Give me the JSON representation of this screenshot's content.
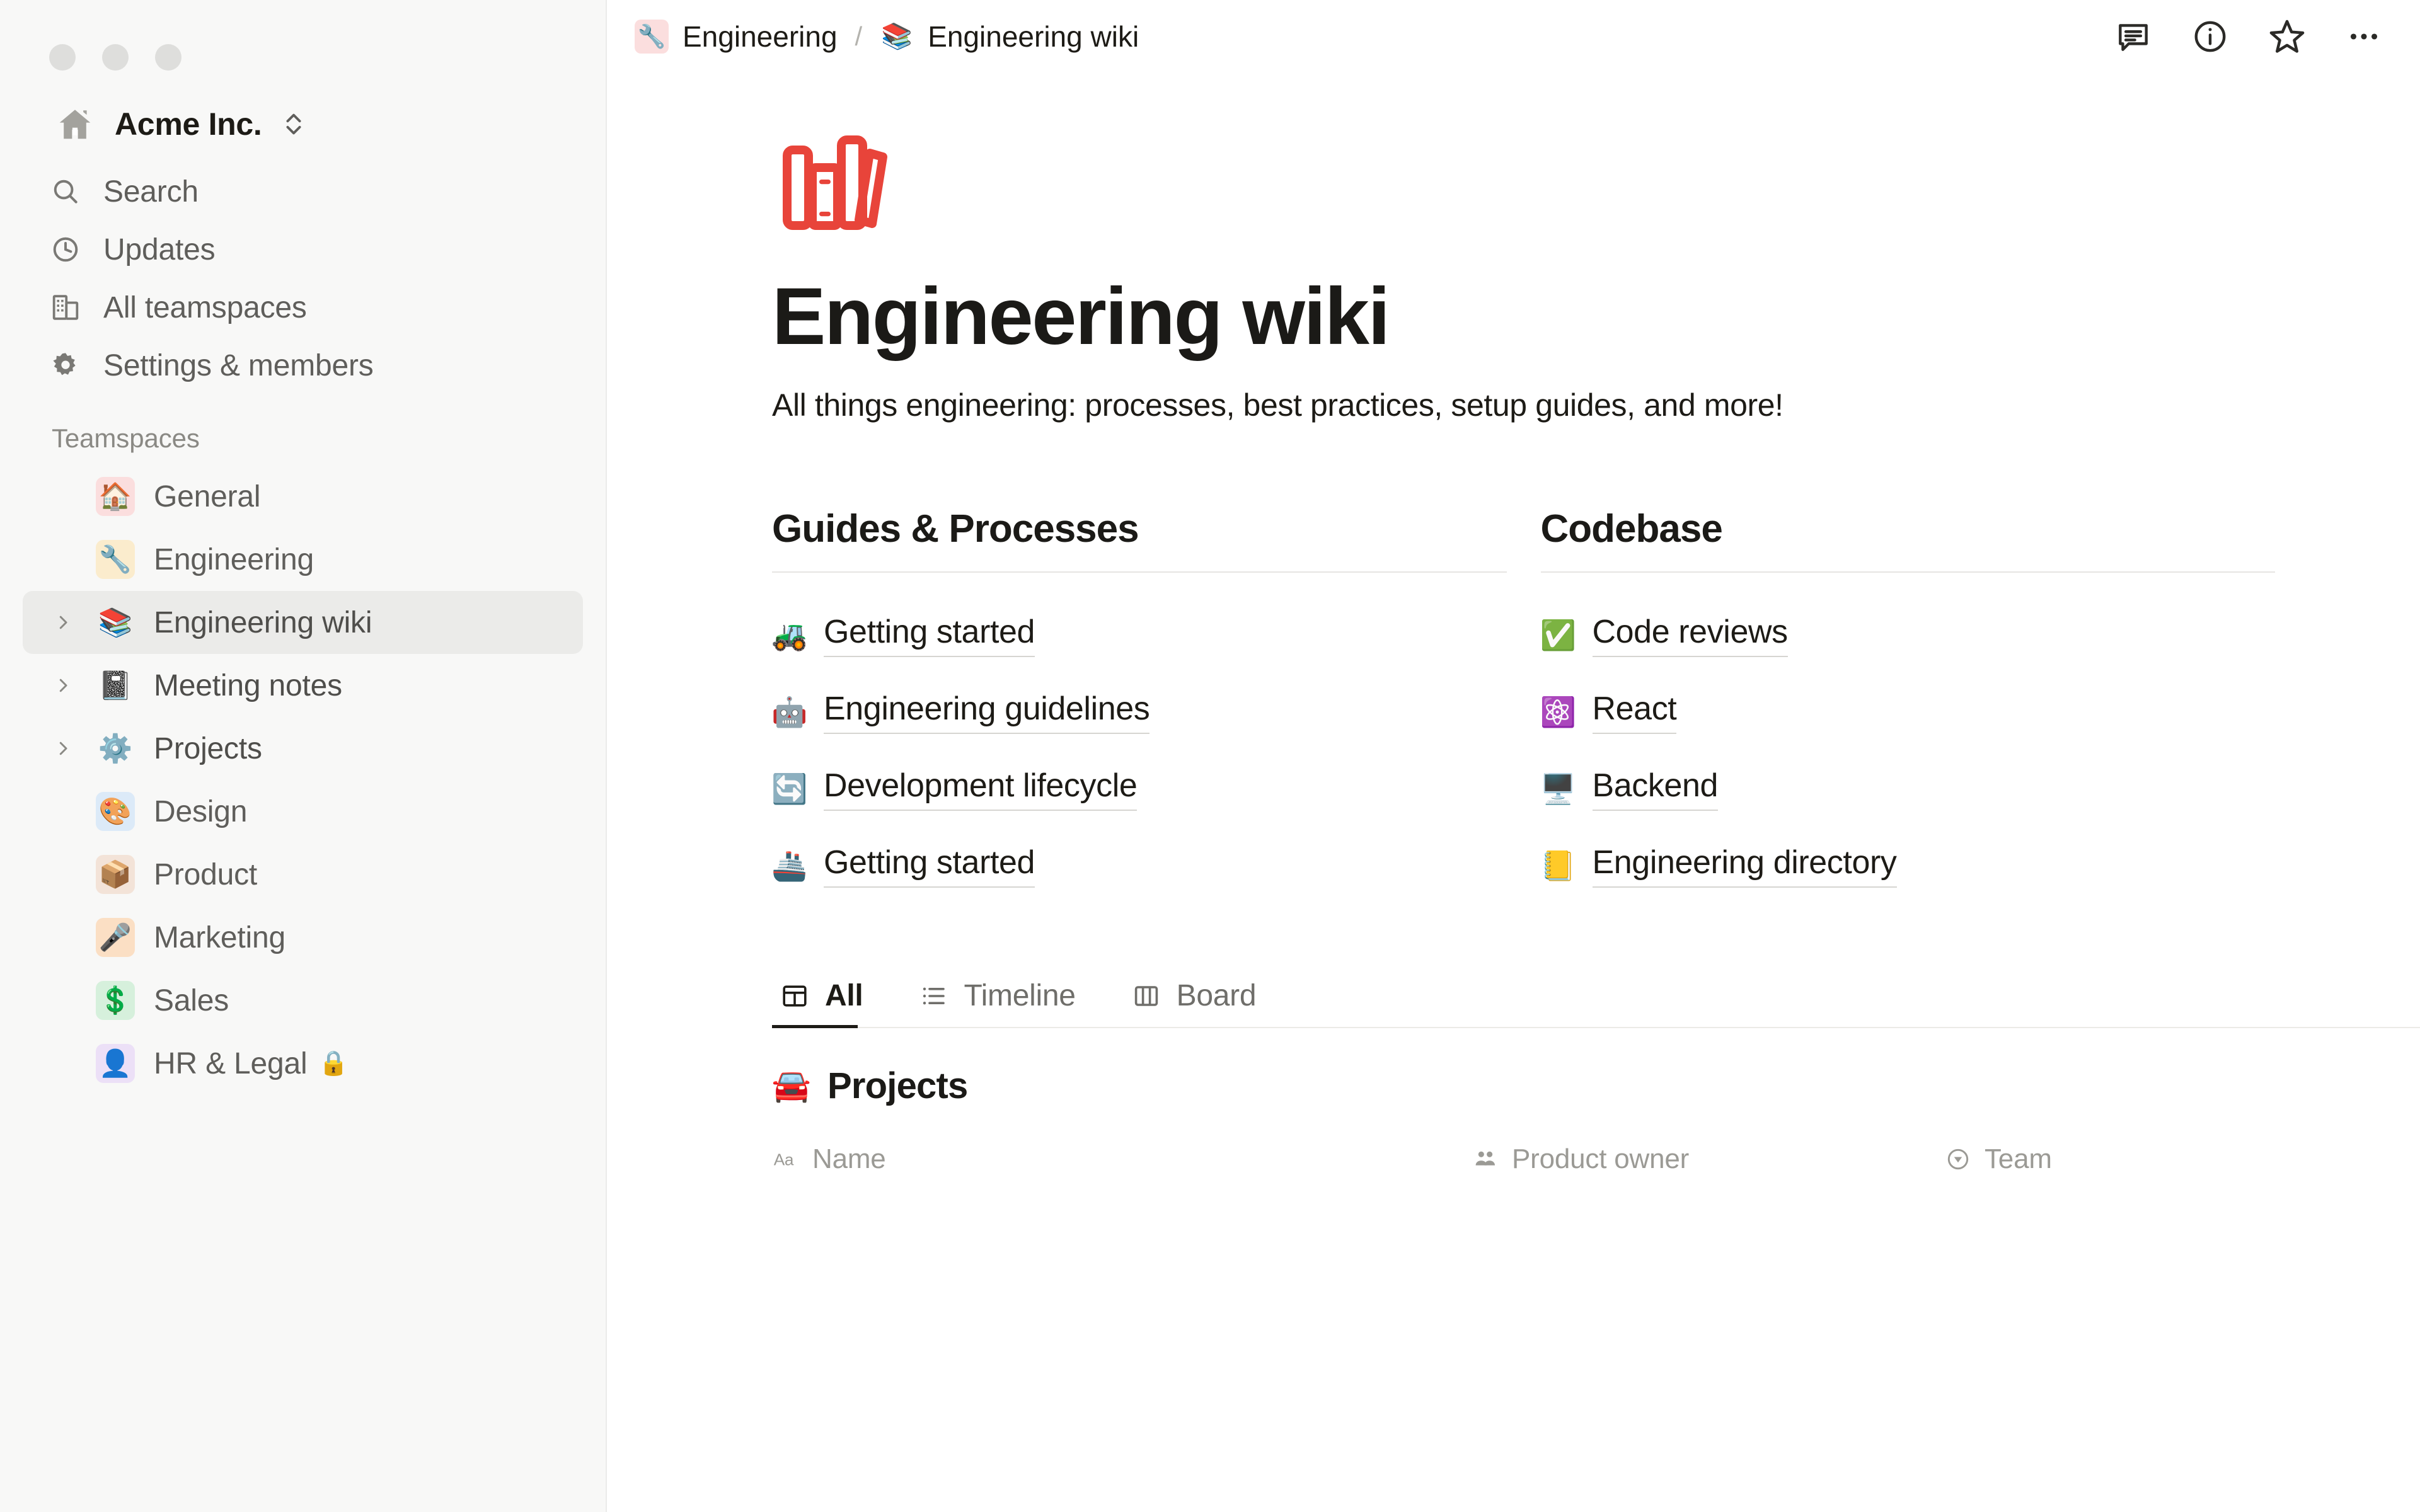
{
  "sidebar": {
    "workspace": {
      "name": "Acme Inc.",
      "icon": "house-icon"
    },
    "nav": [
      {
        "label": "Search",
        "icon": "search-icon"
      },
      {
        "label": "Updates",
        "icon": "clock-icon"
      },
      {
        "label": "All teamspaces",
        "icon": "buildings-icon"
      },
      {
        "label": "Settings & members",
        "icon": "gear-icon"
      }
    ],
    "teamspaces_header": "Teamspaces",
    "teamspaces": [
      {
        "label": "General",
        "emoji": "🏠",
        "tile_bg": "#fbdede",
        "expandable": false,
        "selected": false,
        "locked": false
      },
      {
        "label": "Engineering",
        "emoji": "🔧",
        "tile_bg": "#fbeccd",
        "expandable": false,
        "selected": false,
        "locked": false
      },
      {
        "label": "Engineering wiki",
        "emoji": "📚",
        "tile_bg": "transparent",
        "expandable": true,
        "selected": true,
        "locked": false
      },
      {
        "label": "Meeting notes",
        "emoji": "📓",
        "tile_bg": "transparent",
        "expandable": true,
        "selected": false,
        "locked": false
      },
      {
        "label": "Projects",
        "emoji": "⚙️",
        "tile_bg": "transparent",
        "expandable": true,
        "selected": false,
        "locked": false
      },
      {
        "label": "Design",
        "emoji": "🎨",
        "tile_bg": "#dceaf8",
        "expandable": false,
        "selected": false,
        "locked": false
      },
      {
        "label": "Product",
        "emoji": "📦",
        "tile_bg": "#f3e3d8",
        "expandable": false,
        "selected": false,
        "locked": false
      },
      {
        "label": "Marketing",
        "emoji": "🎤",
        "tile_bg": "#fbdfc4",
        "expandable": false,
        "selected": false,
        "locked": false
      },
      {
        "label": "Sales",
        "emoji": "💲",
        "tile_bg": "#d6f0dc",
        "expandable": false,
        "selected": false,
        "locked": false
      },
      {
        "label": "HR & Legal",
        "emoji": "👤",
        "tile_bg": "#ece0f7",
        "expandable": false,
        "selected": false,
        "locked": true,
        "lock_glyph": "🔒"
      }
    ]
  },
  "topbar": {
    "breadcrumb": [
      {
        "label": "Engineering",
        "emoji": "🔧",
        "tile_bg": "#fbdede"
      },
      {
        "label": "Engineering wiki",
        "emoji": "📚",
        "tile_bg": "transparent"
      }
    ],
    "separator": "/",
    "actions": [
      {
        "name": "comments-icon",
        "title": "Comments"
      },
      {
        "name": "info-icon",
        "title": "Page info"
      },
      {
        "name": "star-icon",
        "title": "Favorite"
      },
      {
        "name": "more-icon",
        "title": "More options"
      }
    ]
  },
  "page": {
    "icon": "books-icon",
    "title": "Engineering wiki",
    "subtitle": "All things engineering: processes, best practices, setup guides, and more!"
  },
  "columns": [
    {
      "title": "Guides & Processes",
      "links": [
        {
          "emoji": "🚜",
          "label": "Getting started"
        },
        {
          "emoji": "🤖",
          "label": "Engineering guidelines"
        },
        {
          "emoji": "🔄",
          "label": "Development lifecycle"
        },
        {
          "emoji": "🚢",
          "label": "Getting started"
        }
      ]
    },
    {
      "title": "Codebase",
      "links": [
        {
          "emoji": "✅",
          "label": "Code reviews"
        },
        {
          "emoji": "⚛️",
          "label": "React"
        },
        {
          "emoji": "🖥️",
          "label": "Backend"
        },
        {
          "emoji": "📒",
          "label": "Engineering directory"
        }
      ]
    }
  ],
  "view_tabs": [
    {
      "label": "All",
      "icon": "table-icon",
      "active": true
    },
    {
      "label": "Timeline",
      "icon": "list-icon",
      "active": false
    },
    {
      "label": "Board",
      "icon": "board-icon",
      "active": false
    }
  ],
  "database": {
    "emoji": "🚘",
    "title": "Projects",
    "columns": [
      {
        "label": "Name",
        "icon": "text-aa-icon"
      },
      {
        "label": "Product owner",
        "icon": "person-icon"
      },
      {
        "label": "Team",
        "icon": "select-icon"
      }
    ]
  },
  "colors": {
    "accent_red": "#e8443a",
    "sidebar_bg": "#f8f8f7",
    "selected_bg": "#ebebe9",
    "text_primary": "#1d1b16",
    "text_secondary": "#5f5e5b",
    "text_muted": "#9b9a95"
  }
}
